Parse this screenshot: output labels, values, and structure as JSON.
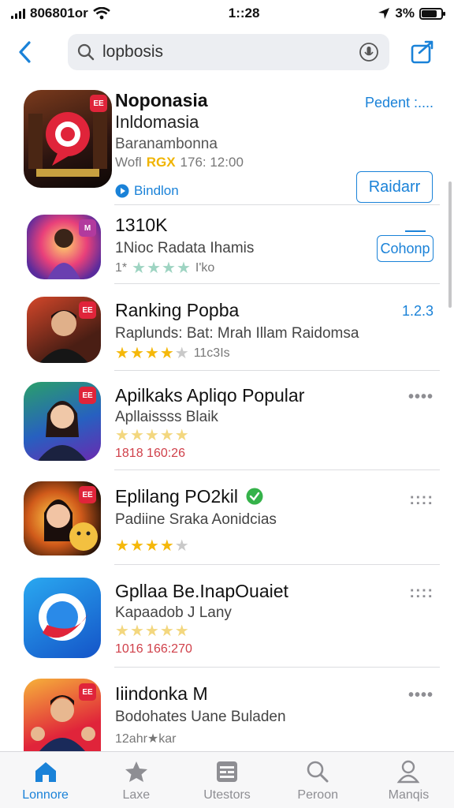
{
  "status_bar": {
    "carrier": "806801or",
    "time": "1::28",
    "battery": "3%"
  },
  "search": {
    "value": "lopbosis"
  },
  "featured": {
    "title": "Noponasia",
    "subtitle": "Inldomasia",
    "developer": "Baranambonna",
    "meta_prefix": "Wofl",
    "meta_highlight": "RGX",
    "meta_suffix": "176: 12:00",
    "badge_label": "Bindlon",
    "top_link": "Pedent :....",
    "action_button": "Raidarr",
    "icon_badge": "EE"
  },
  "apps": [
    {
      "title": "1310K",
      "subtitle": "1Nioc Radata Ihamis",
      "meta": "1*",
      "meta_tail": "I'ko",
      "rating": 4,
      "stars": "mint",
      "action": "Cohonp",
      "more": "",
      "icon_badge": "M"
    },
    {
      "title": "Ranking Popba",
      "subtitle": "Raplunds: Bat: Mrah Illam  Raidomsa",
      "meta": "",
      "meta_tail": "11c3Is",
      "rating": 4,
      "stars": "gold",
      "action": "",
      "more": "1.2.3",
      "icon_badge": "EE"
    },
    {
      "title": "Apilkaks Apliqo Popular",
      "subtitle": "Apllaissss Blaik",
      "meta": "1818  160:26",
      "meta_tail": "",
      "rating": 5,
      "stars": "pale",
      "action": "",
      "more": "••••",
      "icon_badge": "EE"
    },
    {
      "title": "Eplilang PO2kil",
      "subtitle": "Padiine Sraka Aonidcias",
      "meta": "",
      "meta_tail": "",
      "rating": 4,
      "stars": "gold",
      "action": "",
      "more": "::::",
      "icon_badge": "EE"
    },
    {
      "title": "Gpllaa Be.InapOuaiet",
      "subtitle": "Kapaadob J Lany",
      "meta": "1016  166:270",
      "meta_tail": "",
      "rating": 5,
      "stars": "pale",
      "action": "",
      "more": "::::",
      "icon_badge": ""
    },
    {
      "title": "Iiindonka M",
      "subtitle": "Bodohates Uane Buladen",
      "meta": "12ahr★kar",
      "meta_tail": "",
      "rating": 0,
      "stars": "none",
      "action": "",
      "more": "••••",
      "icon_badge": "EE"
    }
  ],
  "tabs": [
    {
      "label": "Lonnore",
      "icon": "home-icon"
    },
    {
      "label": "Laxe",
      "icon": "star-icon"
    },
    {
      "label": "Utestors",
      "icon": "grid-icon"
    },
    {
      "label": "Peroon",
      "icon": "search-icon"
    },
    {
      "label": "Manqis",
      "icon": "person-icon"
    }
  ],
  "colors": {
    "accent": "#1a82d8",
    "star": "#f5b80a",
    "badge": "#e0243a"
  }
}
